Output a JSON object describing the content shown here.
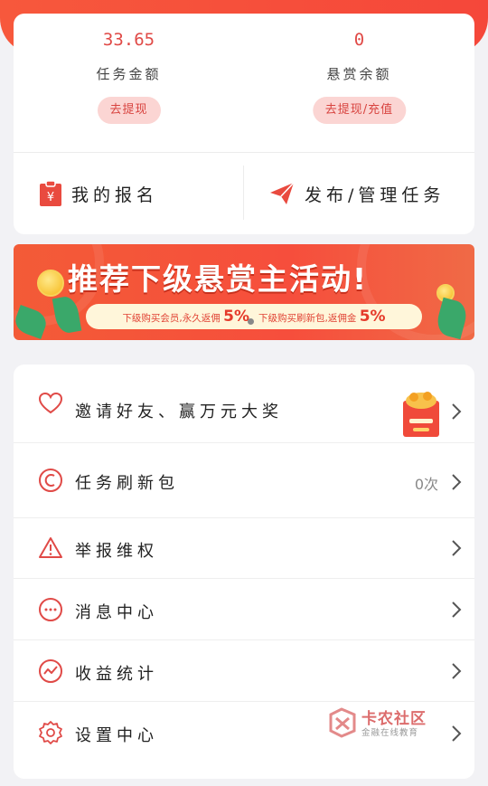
{
  "balances": {
    "task_amount": {
      "value": "33.65",
      "label": "任务金额",
      "button": "去提现"
    },
    "reward_balance": {
      "value": "0",
      "label": "悬赏余额",
      "button": "去提现/充值"
    }
  },
  "actions": {
    "my_signups": "我的报名",
    "publish_manage": "发布/管理任务"
  },
  "banner": {
    "title": "推荐下级悬赏主活动!",
    "strip_left_text": "下级购买会员,永久返佣",
    "strip_left_pct": "5%",
    "strip_right_text": "下级购买刷新包,返佣金",
    "strip_right_pct": "5%"
  },
  "menu": {
    "items": [
      {
        "label": "邀请好友、赢万元大奖",
        "icon": "heart-icon"
      },
      {
        "label": "任务刷新包",
        "icon": "refresh-coin-icon",
        "extra": "0次"
      },
      {
        "label": "举报维权",
        "icon": "warning-icon"
      },
      {
        "label": "消息中心",
        "icon": "message-icon"
      },
      {
        "label": "收益统计",
        "icon": "chart-icon"
      },
      {
        "label": "设置中心",
        "icon": "gear-icon"
      }
    ]
  },
  "watermark": {
    "title": "卡农社区",
    "subtitle": "金融在线教育"
  },
  "colors": {
    "accent": "#e04a47",
    "banner": "#f5553b",
    "button_bg": "#fbd5d3"
  }
}
